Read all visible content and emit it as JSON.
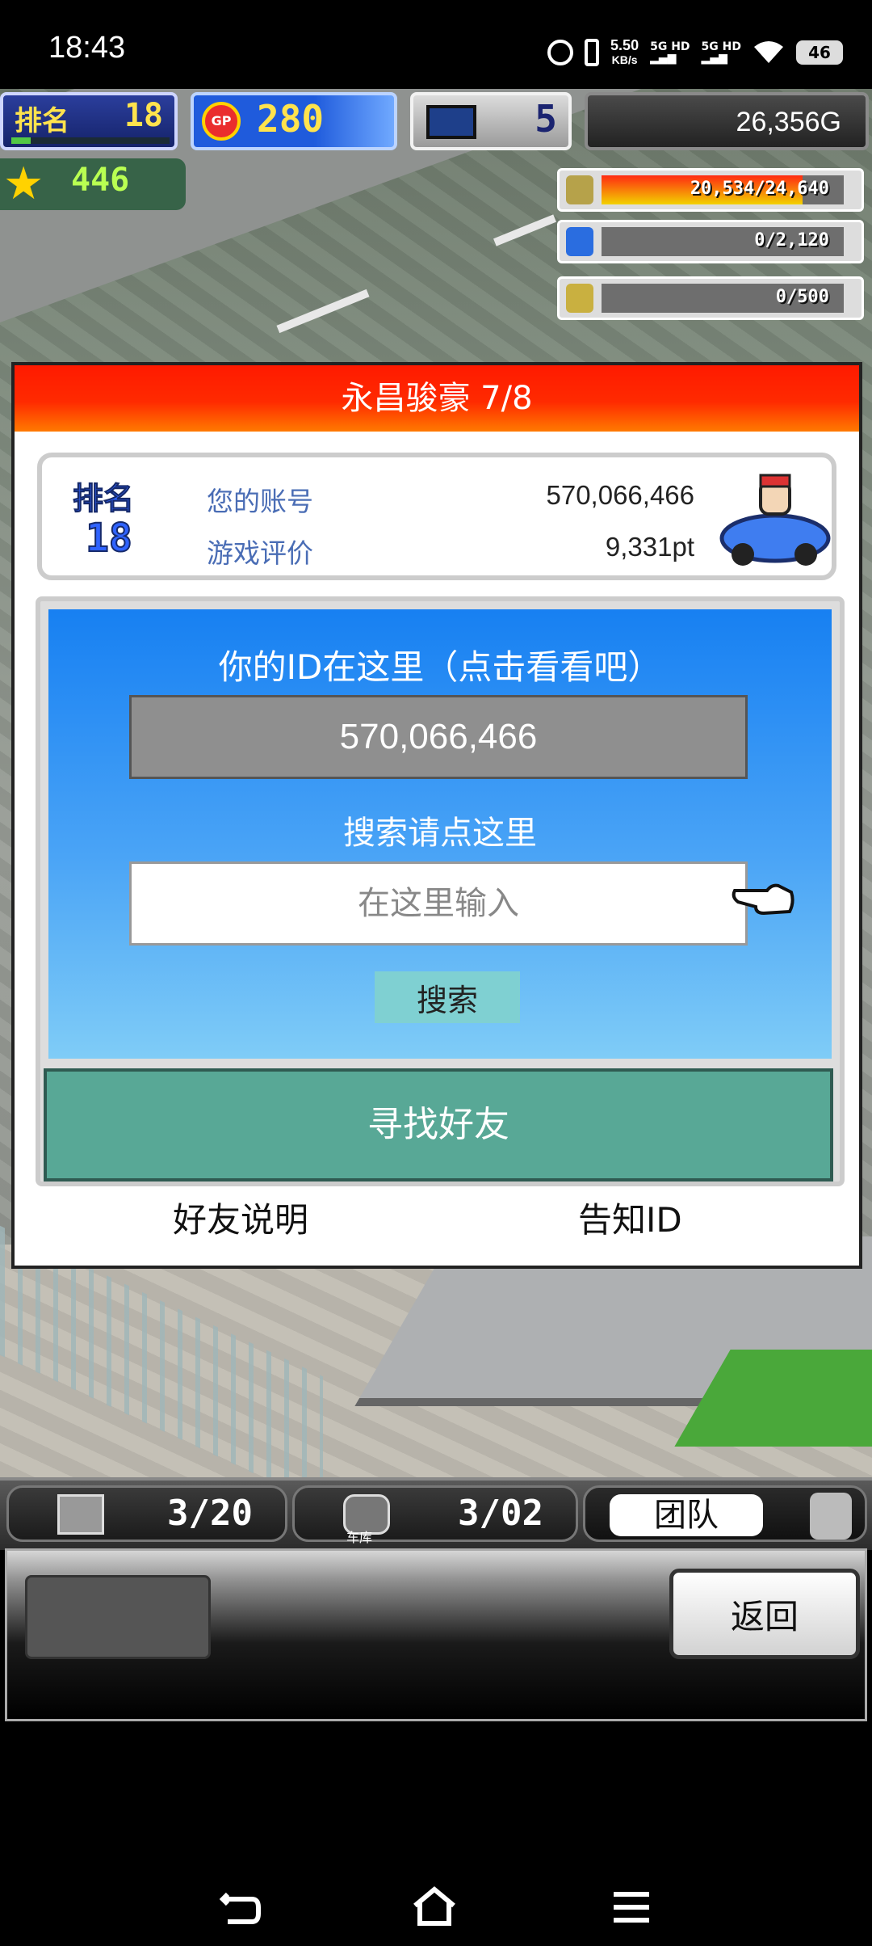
{
  "status_bar": {
    "time": "18:43",
    "speed_value": "5.50",
    "speed_unit": "KB/s",
    "signal1": "5G HD",
    "signal2": "5G HD",
    "battery": "46"
  },
  "hud": {
    "rank_label": "排名",
    "rank_value": "18",
    "rank_progress": 0.12,
    "gp_value": "280",
    "gp_badge": "GP",
    "pc_value": "5",
    "money": "26,356G",
    "stars": "446",
    "resources": [
      {
        "icon": "coin-stack-icon",
        "text": "20,534/24,640",
        "fraction": 0.83
      },
      {
        "icon": "bottle-icon",
        "text": "0/2,120",
        "fraction": 0
      },
      {
        "icon": "wheat-icon",
        "text": "0/500",
        "fraction": 0
      }
    ]
  },
  "dialog": {
    "title": "永昌骏豪 7/8",
    "profile": {
      "rank_label": "排名",
      "rank_value": "18",
      "account_label": "您的账号",
      "account_value": "570,066,466",
      "rating_label": "游戏评价",
      "rating_value": "9,331pt"
    },
    "id_prompt": "你的ID在这里（点击看看吧）",
    "my_id": "570,066,466",
    "search_prompt": "搜索请点这里",
    "search_placeholder": "在这里输入",
    "search_button": "搜索",
    "find_friends": "寻找好友",
    "friend_help": "好友说明",
    "tell_id": "告知ID"
  },
  "bottom": {
    "tab_box_count": "3/20",
    "tab_garage_count": "3/02",
    "tab_garage_label": "车库",
    "tab_team_label": "团队",
    "back_button": "返回"
  },
  "colors": {
    "title_red": "#ff1a00",
    "panel_blue": "#1780f2",
    "find_friends_teal": "#58a896",
    "search_button_aqua": "#7fd0d2"
  }
}
